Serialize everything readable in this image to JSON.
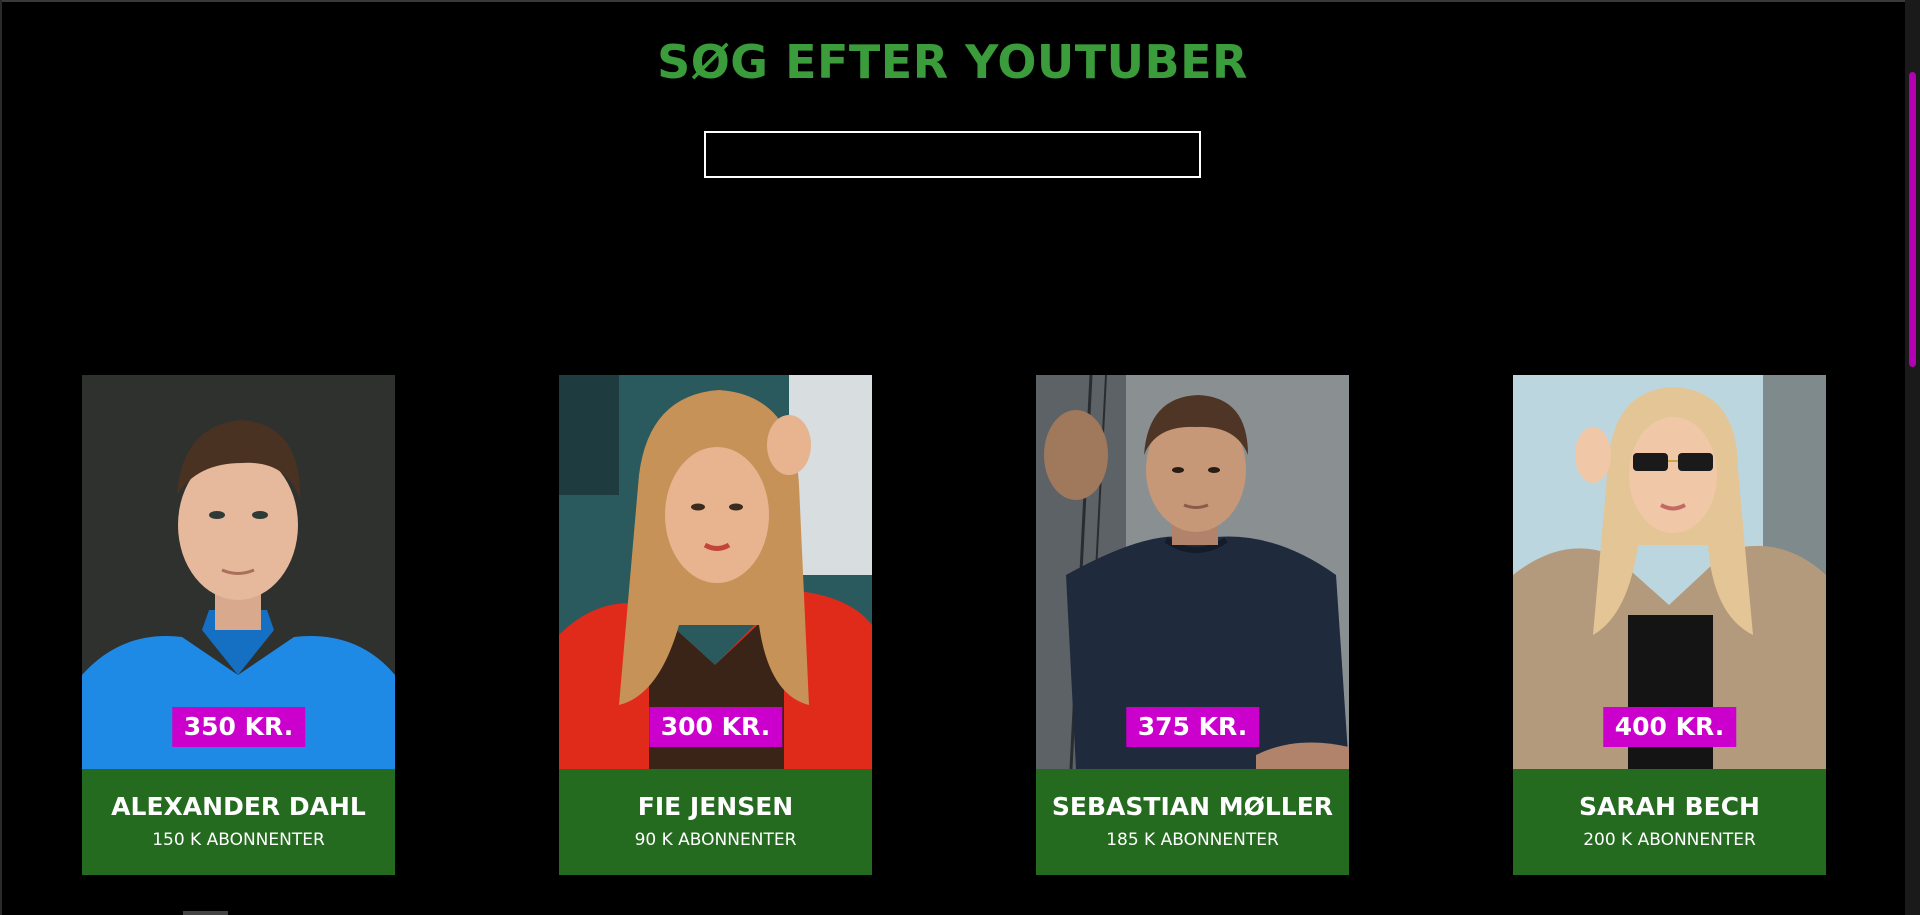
{
  "header": {
    "title": "SØG EFTER YOUTUBER"
  },
  "search": {
    "value": "",
    "placeholder": ""
  },
  "cards": [
    {
      "name": "ALEXANDER DAHL",
      "subscribers": "150 K ABONNENTER",
      "price": "350 KR."
    },
    {
      "name": "FIE JENSEN",
      "subscribers": "90 K ABONNENTER",
      "price": "300 KR."
    },
    {
      "name": "SEBASTIAN MØLLER",
      "subscribers": "185 K ABONNENTER",
      "price": "375 KR."
    },
    {
      "name": "SARAH BECH",
      "subscribers": "200 K ABONNENTER",
      "price": "400 KR."
    }
  ],
  "colors": {
    "background": "#000000",
    "title": "#3a9c3a",
    "card_info": "#246a1f",
    "price_badge": "#cc00cc",
    "scrollbar_thumb": "#b300b3"
  }
}
